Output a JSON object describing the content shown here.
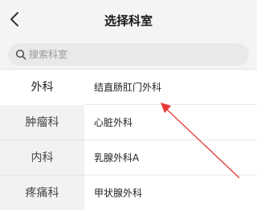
{
  "header": {
    "title": "选择科室",
    "back_icon": "chevron-left-icon"
  },
  "search": {
    "placeholder": "搜索科室",
    "value": "",
    "icon": "search-icon"
  },
  "sidebar": {
    "items": [
      {
        "label": "外科",
        "active": true
      },
      {
        "label": "肿瘤科",
        "active": false
      },
      {
        "label": "内科",
        "active": false
      },
      {
        "label": "疼痛科",
        "active": false
      }
    ]
  },
  "departments": {
    "items": [
      {
        "label": "结直肠肛门外科"
      },
      {
        "label": "心脏外科"
      },
      {
        "label": "乳腺外科A"
      },
      {
        "label": "甲状腺外科"
      }
    ]
  },
  "annotation": {
    "color": "#e53935"
  }
}
